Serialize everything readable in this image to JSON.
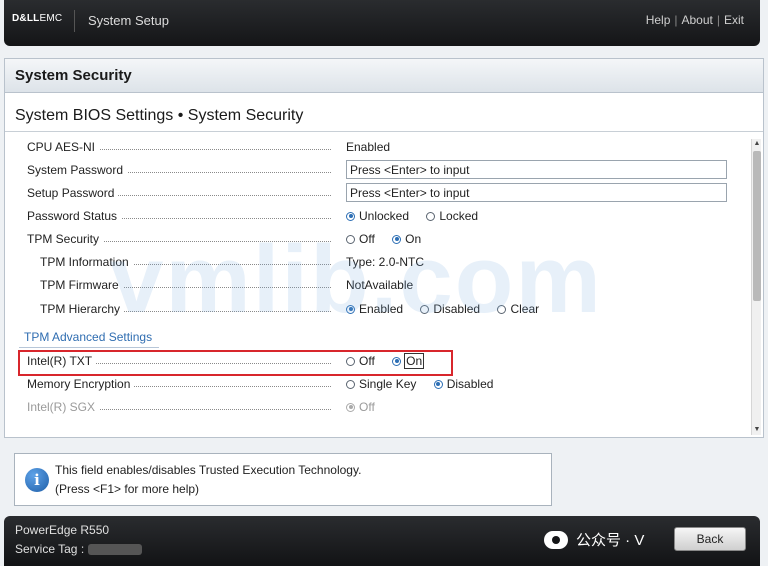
{
  "header": {
    "logo_bold": "D&LL",
    "logo_light": "EMC",
    "app_title": "System Setup",
    "links": [
      "Help",
      "About",
      "Exit"
    ],
    "separator": "|"
  },
  "section": {
    "title": "System Security",
    "page_title": "System BIOS Settings • System Security"
  },
  "settings": {
    "cpu_aes_ni": {
      "label": "CPU AES-NI",
      "value": "Enabled"
    },
    "system_password": {
      "label": "System Password",
      "value": "Press <Enter> to input"
    },
    "setup_password": {
      "label": "Setup Password",
      "value": "Press <Enter> to input"
    },
    "password_status": {
      "label": "Password Status",
      "options": [
        "Unlocked",
        "Locked"
      ],
      "selected": "Unlocked"
    },
    "tpm_security": {
      "label": "TPM Security",
      "options": [
        "Off",
        "On"
      ],
      "selected": "On"
    },
    "tpm_information": {
      "label": "TPM Information",
      "value": "Type: 2.0-NTC"
    },
    "tpm_firmware": {
      "label": "TPM Firmware",
      "value": "NotAvailable"
    },
    "tpm_hierarchy": {
      "label": "TPM Hierarchy",
      "options": [
        "Enabled",
        "Disabled",
        "Clear"
      ],
      "selected": "Enabled"
    },
    "tpm_advanced_link": "TPM Advanced Settings",
    "intel_txt": {
      "label": "Intel(R) TXT",
      "options": [
        "Off",
        "On"
      ],
      "selected": "On"
    },
    "memory_encryption": {
      "label": "Memory Encryption",
      "options": [
        "Single Key",
        "Disabled"
      ],
      "selected": "Disabled"
    },
    "intel_sgx": {
      "label": "Intel(R) SGX",
      "options": [
        "Off"
      ],
      "selected": "Off"
    }
  },
  "watermark": "vmlib.com",
  "help": {
    "line1": "This field enables/disables Trusted Execution Technology.",
    "line2": "(Press <F1> for more help)"
  },
  "footer": {
    "model": "PowerEdge R550",
    "service_tag_label": "Service Tag :",
    "wechat_text": "公众号 · V",
    "back_label": "Back"
  },
  "colors": {
    "accent": "#2d6fb5",
    "highlight_border": "#d8262c",
    "link": "#2f6db1"
  }
}
